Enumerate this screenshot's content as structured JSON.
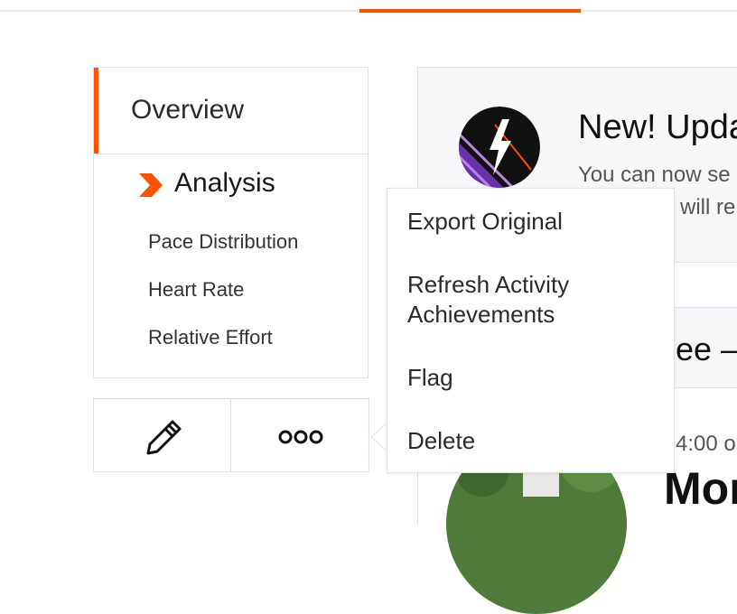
{
  "nav": {
    "overview": "Overview",
    "analysis": "Analysis",
    "sub_items": [
      "Pace Distribution",
      "Heart Rate",
      "Relative Effort"
    ]
  },
  "actions": {
    "edit_icon": "pencil-icon",
    "more_icon": "ellipsis-icon"
  },
  "dropdown": {
    "items": [
      "Export Original",
      "Refresh Activity Achievements",
      "Flag",
      "Delete"
    ],
    "item_lines": [
      [
        "Export Original"
      ],
      [
        "Refresh Activity",
        "Achievements"
      ],
      [
        "Flag"
      ],
      [
        "Delete"
      ]
    ]
  },
  "update_card": {
    "title": "New! Upda",
    "line1": "You can now se",
    "line2": "will re"
  },
  "activity": {
    "title": "ee –",
    "time": "4:00 o",
    "name": "Mon"
  },
  "colors": {
    "accent": "#fc5200",
    "border": "#dfdfe8",
    "badge_bg": "#111111",
    "badge_stripe": "#6b2fa8"
  }
}
